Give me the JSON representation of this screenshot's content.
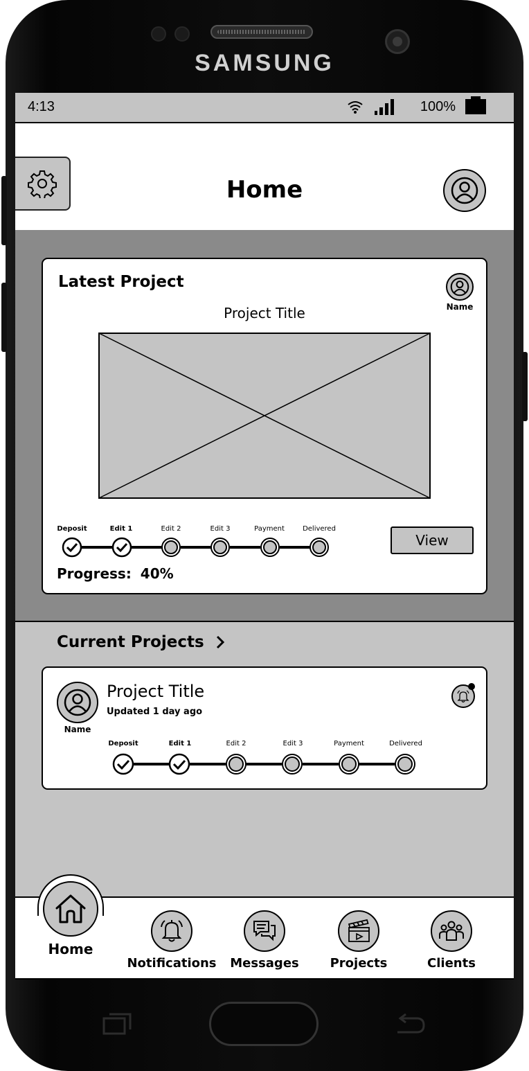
{
  "device": {
    "brand": "SAMSUNG"
  },
  "status_bar": {
    "time": "4:13",
    "battery": "100%"
  },
  "header": {
    "title": "Home"
  },
  "latest_project": {
    "heading": "Latest Project",
    "owner_name": "Name",
    "project_title": "Project Title",
    "steps": [
      {
        "label": "Deposit",
        "done": true
      },
      {
        "label": "Edit 1",
        "done": true
      },
      {
        "label": "Edit 2",
        "done": false
      },
      {
        "label": "Edit 3",
        "done": false
      },
      {
        "label": "Payment",
        "done": false
      },
      {
        "label": "Delivered",
        "done": false
      }
    ],
    "view_label": "View",
    "progress_label": "Progress:",
    "progress_value": "40%"
  },
  "current_projects": {
    "heading": "Current Projects",
    "items": [
      {
        "title": "Project Title",
        "updated": "Updated 1 day ago",
        "owner_name": "Name",
        "has_notification": true,
        "steps": [
          {
            "label": "Deposit",
            "done": true
          },
          {
            "label": "Edit 1",
            "done": true
          },
          {
            "label": "Edit 2",
            "done": false
          },
          {
            "label": "Edit 3",
            "done": false
          },
          {
            "label": "Payment",
            "done": false
          },
          {
            "label": "Delivered",
            "done": false
          }
        ]
      }
    ]
  },
  "bottom_nav": {
    "active": "Home",
    "items": [
      {
        "label": "Home",
        "icon": "home-icon"
      },
      {
        "label": "Notifications",
        "icon": "bell-icon"
      },
      {
        "label": "Messages",
        "icon": "chat-icon"
      },
      {
        "label": "Projects",
        "icon": "clapperboard-icon"
      },
      {
        "label": "Clients",
        "icon": "users-icon"
      }
    ]
  }
}
